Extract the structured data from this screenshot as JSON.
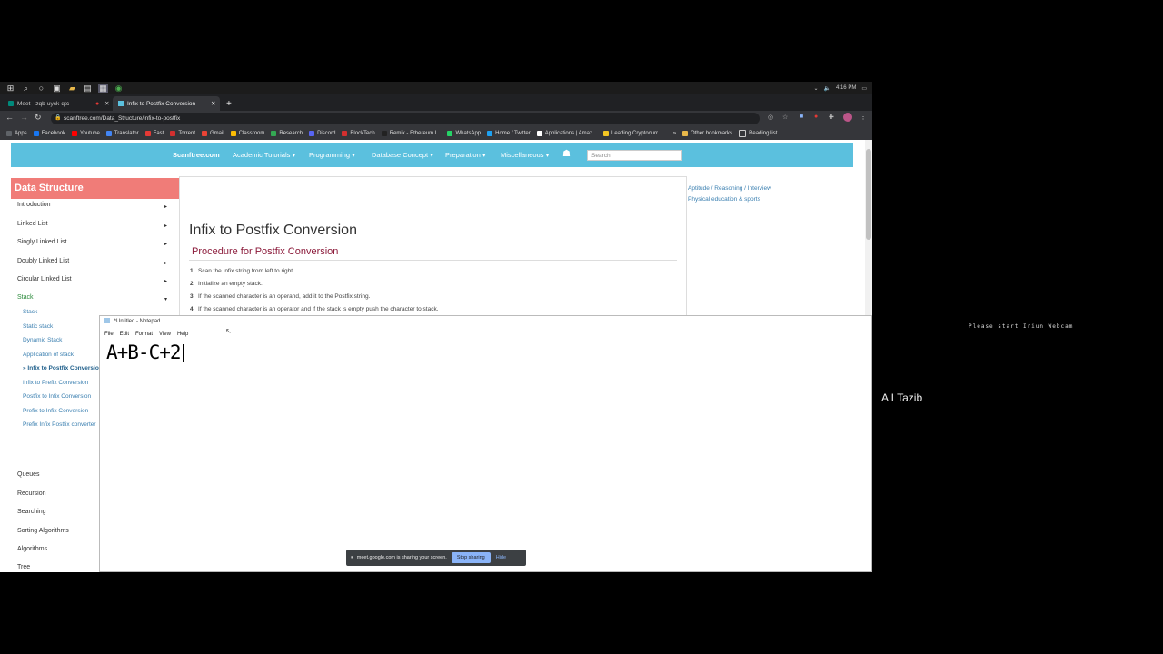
{
  "taskbar": {
    "time": "4:16 PM",
    "icons": [
      "windows-icon",
      "search-icon",
      "cortana-icon",
      "taskview-icon",
      "folder-icon",
      "notepad-icon",
      "explorer-icon",
      "chrome-icon"
    ]
  },
  "browser": {
    "tabs": [
      {
        "title": "Meet - zqb-uyck-qtc",
        "recording": true
      },
      {
        "title": "Infix to Postfix Conversion",
        "active": true
      }
    ],
    "new_tab": "+",
    "close": "✕",
    "url": "scanftree.com/Data_Structure/infix-to-postfix",
    "bookmarks": [
      {
        "label": "Apps",
        "color": "#5f6368"
      },
      {
        "label": "Facebook",
        "color": "#1877f2"
      },
      {
        "label": "Youtube",
        "color": "#ff0000"
      },
      {
        "label": "Translator",
        "color": "#4285f4"
      },
      {
        "label": "Fast",
        "color": "#e53935"
      },
      {
        "label": "Torrent",
        "color": "#d32f2f"
      },
      {
        "label": "Gmail",
        "color": "#ea4335"
      },
      {
        "label": "Classroom",
        "color": "#fbbc04"
      },
      {
        "label": "Research",
        "color": "#34a853"
      },
      {
        "label": "Discord",
        "color": "#5865f2"
      },
      {
        "label": "BlockTech",
        "color": "#d32f2f"
      },
      {
        "label": "Remix - Ethereum I...",
        "color": "#222222"
      },
      {
        "label": "WhatsApp",
        "color": "#25d366"
      },
      {
        "label": "Home / Twitter",
        "color": "#1da1f2"
      },
      {
        "label": "Applications | Amaz...",
        "color": "#ffffff"
      },
      {
        "label": "Leading Cryptocurr...",
        "color": "#f3c623"
      }
    ],
    "more": "»",
    "other_bookmarks": "Other bookmarks",
    "reading_list": "Reading list"
  },
  "site": {
    "brand": "Scanftree.com",
    "nav": [
      "Academic Tutorials",
      "Programming",
      "Database Concept",
      "Preparation",
      "Miscellaneous"
    ],
    "search_placeholder": "Search",
    "sidebar_title": "Data Structure",
    "sidebar_items": [
      "Introduction",
      "Linked List",
      "Singly Linked List",
      "Doubly Linked List",
      "Circular Linked List",
      "Stack"
    ],
    "stack_subitems": [
      "Stack",
      "Static stack",
      "Dynamic Stack",
      "Application of stack",
      "» Infix to Postfix Conversion",
      "Infix to Prefix Conversion",
      "Postfix to Infix Conversion",
      "Prefix to Infix Conversion",
      "Prefix Infix Postfix converter"
    ],
    "sidebar_items_after": [
      "Queues",
      "Recursion",
      "Searching",
      "Sorting Algorithms",
      "Algorithms",
      "Tree"
    ],
    "page_title": "Infix to Postfix Conversion",
    "procedure_title": "Procedure for Postfix Conversion",
    "steps": [
      {
        "n": "1.",
        "text": "Scan the Infix string from left to right."
      },
      {
        "n": "2.",
        "text": "Initialize an empty stack."
      },
      {
        "n": "3.",
        "text": "If the scanned character is an operand, add it to the Postfix string."
      },
      {
        "n": "4.",
        "text": "If the scanned character is an operator and if the stack is empty push the character to stack."
      }
    ],
    "right_links": [
      "Aptitude / Reasoning / Interview",
      "Physical education & sports"
    ]
  },
  "notepad": {
    "title": "*Untitled - Notepad",
    "menu": [
      "File",
      "Edit",
      "Format",
      "View",
      "Help"
    ],
    "content": "A+B-C+2"
  },
  "sharebar": {
    "message": "meet.google.com is sharing your screen.",
    "stop_label": "Stop sharing",
    "hide_label": "Hide"
  },
  "meet": {
    "webcam_message": "Please start Iriun Webcam",
    "participant_name": "A I Tazib"
  }
}
